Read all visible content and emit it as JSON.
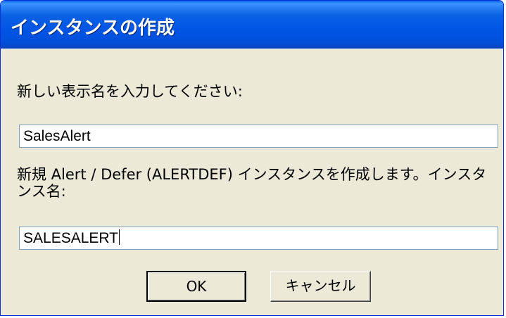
{
  "dialog": {
    "title": "インスタンスの作成",
    "display_name_label": "新しい表示名を入力してください:",
    "display_name_value": "SalesAlert",
    "instance_description": "新規 Alert / Defer (ALERTDEF) インスタンスを作成します。インスタンス名:",
    "instance_name_value": "SALESALERT",
    "ok_label": "OK",
    "cancel_label": "キャンセル"
  }
}
